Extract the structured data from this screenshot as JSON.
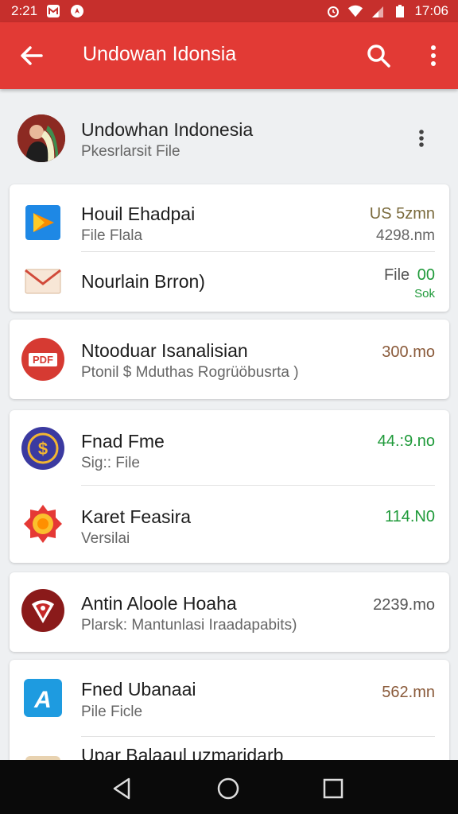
{
  "status_bar": {
    "time_left": "2:21",
    "time_right": "17:06",
    "icons": [
      "gmail-icon",
      "navigation-icon",
      "alarm-icon",
      "wifi-icon",
      "signal-icon",
      "battery-icon"
    ]
  },
  "app_bar": {
    "title": "Undowan Idonsia",
    "icons": [
      "back-arrow-icon",
      "search-icon",
      "more-vert-icon"
    ]
  },
  "header": {
    "name": "Undowhan Indonesia",
    "subtitle": "Pkesrlarsit File"
  },
  "items": [
    {
      "title": "Houil Ehadpai",
      "subtitle": "File Flala",
      "value": "US 5zmn",
      "value2": "4298.nm",
      "value_color": "#7a6a3c"
    },
    {
      "title": "Nourlain Brron)",
      "subtitle": "",
      "value": "File",
      "value_extra": "00",
      "value2": "Sok",
      "value_color": "#555555",
      "extra_color": "#1f9a3a"
    },
    {
      "title": "Ntooduar Isanalisian",
      "subtitle": "Ptonil $ Mduthas Rogrüöbusrta )",
      "value": "300.mo",
      "value2": "",
      "value_color": "#8a5a3a"
    },
    {
      "title": "Fnad Fme",
      "subtitle": "Sig:: File",
      "value": "44.:9.no",
      "value2": "",
      "value_color": "#1f9a3a"
    },
    {
      "title": "Karet Feasira",
      "subtitle": "Versilai",
      "value": "114.N0",
      "value2": "",
      "value_color": "#1f9a3a"
    },
    {
      "title": "Antin Aloole Hoaha",
      "subtitle": "Plarsk: Mantunlasi Iraadapabits)",
      "value": "2239.mo",
      "value2": "",
      "value_color": "#555555"
    },
    {
      "title": "Fned Ubanaai",
      "subtitle": "Pile Ficle",
      "value": "562.mn",
      "value2": "",
      "value_color": "#8a5a3a"
    },
    {
      "title": "Upar Balaaul uzmaridarb",
      "subtitle": "",
      "value": "",
      "value2": "",
      "value_color": "#555555"
    }
  ],
  "colors": {
    "app_bar": "#e23a35",
    "status_bar": "#c62f2c",
    "background": "#eef0f2"
  }
}
